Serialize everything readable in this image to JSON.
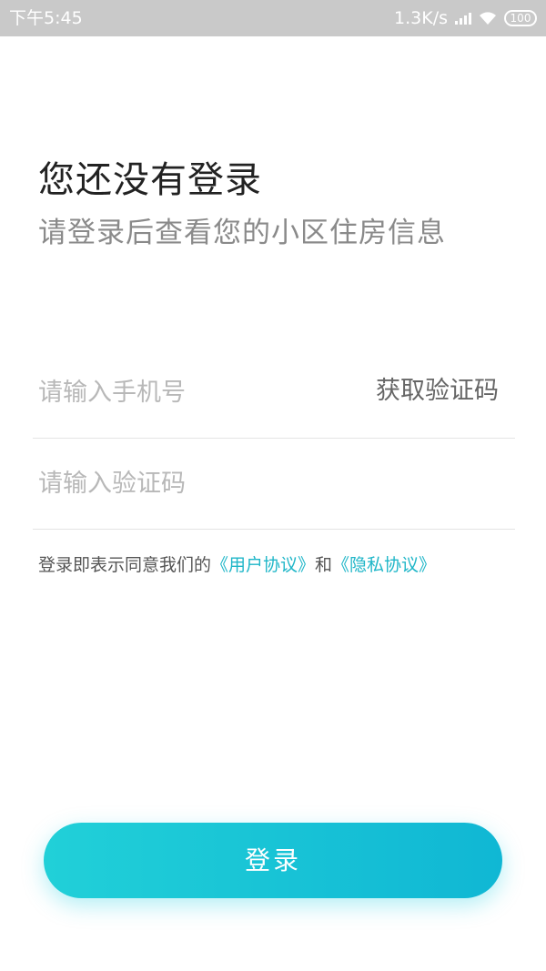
{
  "status_bar": {
    "time": "下午5:45",
    "network_speed": "1.3K/s",
    "battery": "100"
  },
  "header": {
    "title": "您还没有登录",
    "subtitle": "请登录后查看您的小区住房信息"
  },
  "form": {
    "phone_placeholder": "请输入手机号",
    "get_code_label": "获取验证码",
    "code_placeholder": "请输入验证码"
  },
  "agreement": {
    "prefix": "登录即表示同意我们的",
    "user_agreement": "《用户协议》",
    "conjunction": "和",
    "privacy_policy": "《隐私协议》"
  },
  "login_button": {
    "label": "登录"
  },
  "colors": {
    "accent": "#1fb6c8",
    "button_start": "#21d0d8",
    "button_end": "#10b7d4"
  }
}
